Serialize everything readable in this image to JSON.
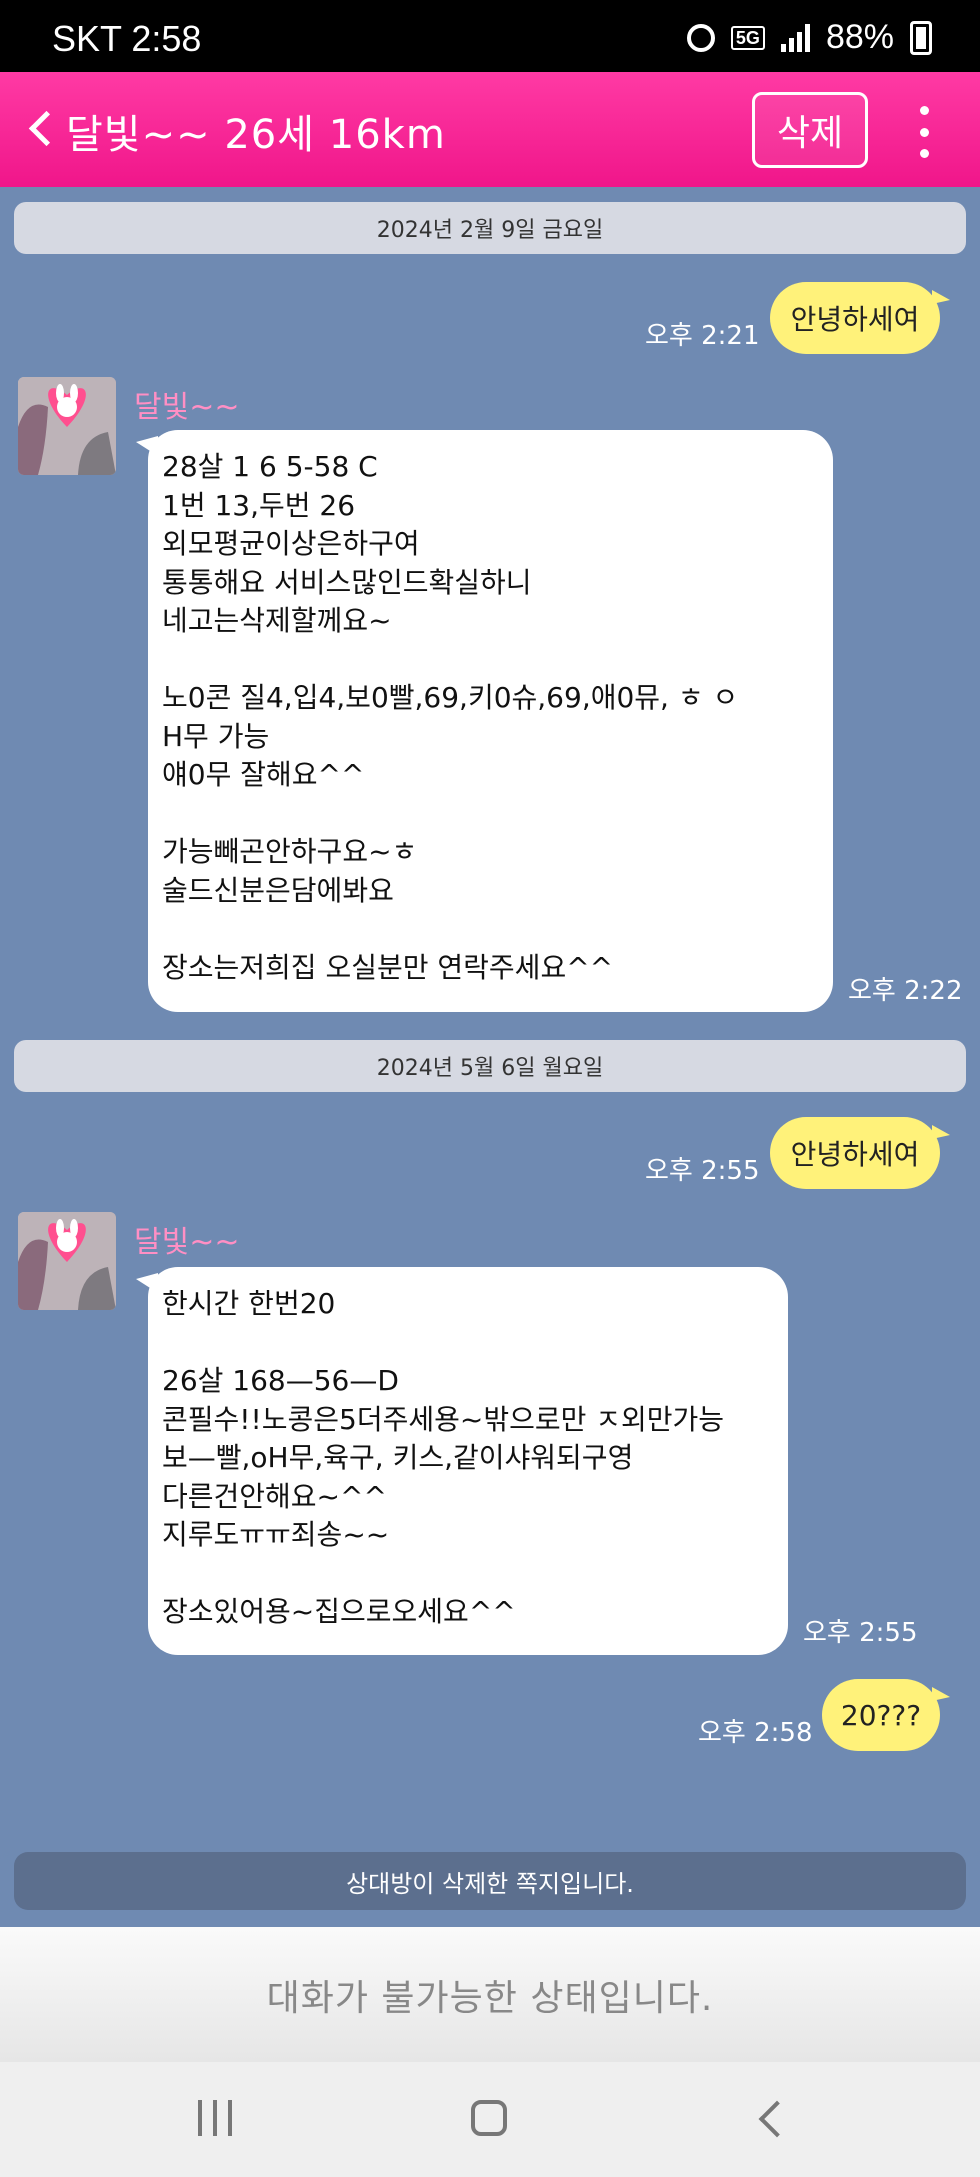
{
  "status_bar": {
    "carrier_time": "SKT 2:58",
    "network": "5G",
    "battery": "88%",
    "icons": [
      "alarm-icon",
      "5g-icon",
      "signal-icon",
      "battery-charging-icon"
    ]
  },
  "header": {
    "title": "달빛~~ 26세 16km",
    "delete_label": "삭제",
    "icons": [
      "back-icon",
      "more-vertical-icon"
    ]
  },
  "chat": {
    "dates": [
      "2024년 2월 9일 금요일",
      "2024년 5월 6일 월요일"
    ],
    "messages": [
      {
        "from": "me",
        "text": "안녕하세여",
        "time": "오후 2:21"
      },
      {
        "from": "them",
        "sender": "달빛~~",
        "text": "28살 1 6 5-58 C\n1번 13,두번 26\n외모평균이상은하구여\n통통해요 서비스많인드확실하니\n네고는삭제할께요~\n\n노0콘 질4,입4,보0빨,69,키0슈,69,애0뮤, ㅎ ㅇ\nH무 가능\n얘0무 잘해요^^\n\n가능빼곤안하구요~ㅎ\n술드신분은담에봐요\n\n장소는저희집 오실분만 연락주세요^^",
        "time": "오후 2:22"
      },
      {
        "from": "me",
        "text": "안녕하세여",
        "time": "오후 2:55"
      },
      {
        "from": "them",
        "sender": "달빛~~",
        "text": "한시간 한번20\n\n26살 168—56—D\n콘필수!!노콩은5더주세용~밖으로만 ㅈ외만가능\n보—빨,oH무,육구, 키스,같이샤워되구영\n다른건안해요~^^\n지루도ㅠㅠ죄송~~\n\n장소있어용~집으로오세요^^",
        "time": "오후 2:55"
      },
      {
        "from": "me",
        "text": "20???",
        "time": "오후 2:58"
      }
    ],
    "notice": "상대방이 삭제한 쪽지입니다."
  },
  "footer": {
    "disabled_message": "대화가 불가능한 상태입니다.",
    "nav_icons": [
      "recent-apps-icon",
      "home-icon",
      "back-nav-icon"
    ]
  },
  "colors": {
    "header": "#f0168a",
    "chat_bg": "#6f8ab2",
    "my_bubble": "#fff27a",
    "their_bubble": "#ffffff",
    "sender_name": "#ff8fc4"
  }
}
